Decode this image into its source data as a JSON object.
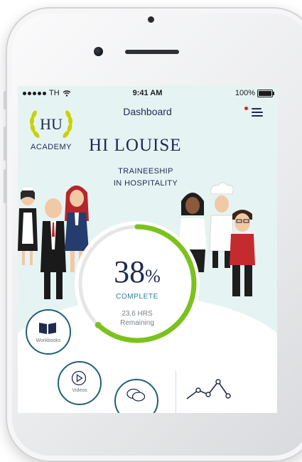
{
  "status_bar": {
    "carrier": "TH",
    "time": "9:41 AM",
    "battery": "100%"
  },
  "header": {
    "title": "Dashboard",
    "menu_icon": "hamburger-menu-icon",
    "notification_color": "#e0202a"
  },
  "logo": {
    "initials": "HU",
    "wordmark": "ACADEMY"
  },
  "greeting": "HI LOUISE",
  "program": {
    "line1": "TRAINEESHIP",
    "line2": "IN HOSPITALITY"
  },
  "progress": {
    "percent_number": "38",
    "percent_sign": "%",
    "fraction": 0.62,
    "label": "COMPLETE",
    "hours": "23.6 HRS",
    "remaining_label": "Remaining",
    "accent_color": "#7cc21f",
    "track_color": "#e6e6e6"
  },
  "actions": [
    {
      "label": "Workbooks",
      "icon": "book-icon"
    },
    {
      "label": "Videos",
      "icon": "play-icon"
    },
    {
      "label": "",
      "icon": "chat-bubbles-icon"
    },
    {
      "label": "",
      "icon": "line-chart-icon"
    }
  ],
  "colors": {
    "navy": "#1f2a52",
    "teal": "#1f5f7b",
    "screen_bg": "#e6f3f3"
  }
}
